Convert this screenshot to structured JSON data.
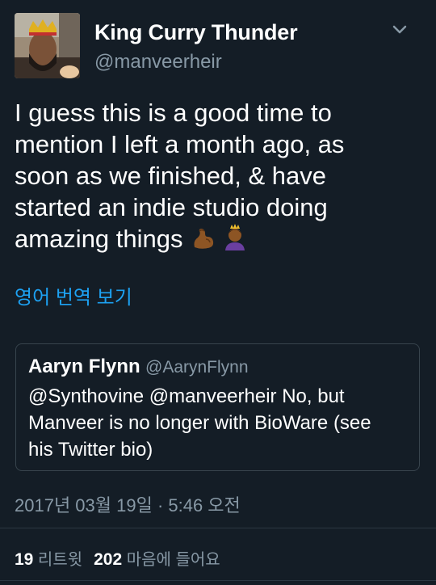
{
  "author": {
    "display_name": "King Curry Thunder",
    "handle": "@manveerheir"
  },
  "tweet": {
    "line1": "I guess this is a good time to",
    "line2": "mention I left a month ago, as",
    "line3": "soon as we finished, & have",
    "line4": "started an indie studio doing",
    "line5": "amazing things",
    "emojis": [
      "flexed-biceps-emoji",
      "person-with-crown-emoji"
    ]
  },
  "translate_label": "영어 번역 보기",
  "quoted_tweet": {
    "display_name": "Aaryn Flynn",
    "handle": "@AarynFlynn",
    "line1": "@Synthovine @manveerheir No, but",
    "line2": "Manveer is no longer with BioWare (see",
    "line3": "his Twitter bio)"
  },
  "timestamp": "2017년 03월 19일 · 5:46 오전",
  "stats": {
    "retweets_count": "19",
    "retweets_label": "리트윗",
    "likes_count": "202",
    "likes_label": "마음에 들어요"
  },
  "colors": {
    "background": "#141d26",
    "link": "#1da1f2",
    "secondary_text": "#8899a6"
  }
}
